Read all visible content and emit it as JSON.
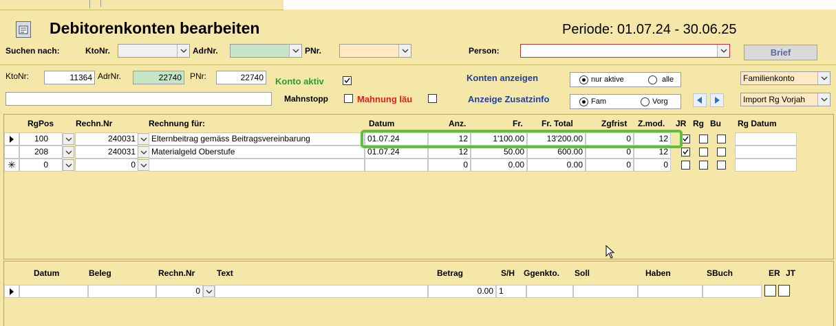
{
  "title": "Debitorenkonten bearbeiten",
  "periode": "Periode: 01.07.24 - 30.06.25",
  "search": {
    "label": "Suchen nach:",
    "ktonr_label": "KtoNr.",
    "adrnr_label": "AdrNr.",
    "pnr_label": "PNr.",
    "person_label": "Person:",
    "brief_button": "Brief"
  },
  "account": {
    "ktonr_label": "KtoNr:",
    "ktonr": "11364",
    "adrnr_label": "AdrNr.",
    "adrnr": "22740",
    "pnr_label": "PNr:",
    "pnr": "22740",
    "konto_aktiv_label": "Konto aktiv",
    "mahnstopp_label": "Mahnstopp",
    "mahnung_label": "Mahnung läu",
    "konten_anzeigen_label": "Konten anzeigen",
    "nur_aktive_label": "nur aktive",
    "alle_label": "alle",
    "zusatzinfo_label": "Anzeige Zusatzinfo",
    "fam_label": "Fam",
    "vorg_label": "Vorg",
    "familienkonto": "Familienkonto",
    "import_rg": "Import Rg Vorjah"
  },
  "invoice_table": {
    "headers": {
      "rgpos": "RgPos",
      "rechnnr": "Rechn.Nr",
      "fuer": "Rechnung für:",
      "datum": "Datum",
      "anz": "Anz.",
      "fr": "Fr.",
      "frtotal": "Fr. Total",
      "zgfrist": "Zgfrist",
      "zmod": "Z.mod.",
      "jr": "JR",
      "rg": "Rg",
      "bu": "Bu",
      "rgdatum": "Rg Datum"
    },
    "rows": [
      {
        "rgpos": "100",
        "rechnnr": "240031",
        "fuer": "Elternbeitrag gemäss Beitragsvereinbarung",
        "datum": "01.07.24",
        "anz": "12",
        "fr": "1'100.00",
        "frtotal": "13'200.00",
        "zgfrist": "0",
        "zmod": "12",
        "jr": true,
        "rg": false,
        "bu": false
      },
      {
        "rgpos": "208",
        "rechnnr": "240031",
        "fuer": "Materialgeld Oberstufe",
        "datum": "01.07.24",
        "anz": "12",
        "fr": "50.00",
        "frtotal": "600.00",
        "zgfrist": "0",
        "zmod": "12",
        "jr": true,
        "rg": false,
        "bu": false
      },
      {
        "rgpos": "0",
        "rechnnr": "0",
        "fuer": "",
        "datum": "",
        "anz": "0",
        "fr": "0.00",
        "frtotal": "0.00",
        "zgfrist": "0",
        "zmod": "0",
        "jr": false,
        "rg": false,
        "bu": false
      }
    ]
  },
  "booking_table": {
    "headers": {
      "datum": "Datum",
      "beleg": "Beleg",
      "rechnnr": "Rechn.Nr",
      "text": "Text",
      "betrag": "Betrag",
      "sh": "S/H",
      "ggenkto": "Ggenkto.",
      "soll": "Soll",
      "haben": "Haben",
      "sbuch": "SBuch",
      "er": "ER",
      "jt": "JT"
    },
    "row": {
      "rechnnr": "0",
      "betrag": "0.00",
      "sh": "1"
    }
  },
  "colors": {
    "background": "#f4e7a8",
    "highlight": "#5fbf3f",
    "label_blue": "#1f3f9f",
    "konto_aktiv": "#2e9d2e",
    "mahnung": "#e02020"
  }
}
